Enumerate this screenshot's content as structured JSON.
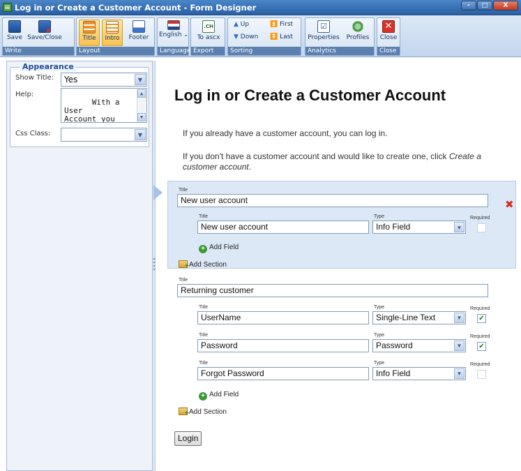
{
  "window": {
    "title": "Log in or Create a Customer Account - Form Designer",
    "controls": [
      "-",
      "□",
      "X"
    ]
  },
  "ribbon": {
    "write": {
      "label": "Write",
      "save": "Save",
      "save_close": "Save/Close"
    },
    "layout": {
      "label": "Layout",
      "title": "Title",
      "intro": "Intro",
      "footer": "Footer"
    },
    "language": {
      "label": "Language",
      "english": "English"
    },
    "export": {
      "label": "Export",
      "to_ascx": "To ascx"
    },
    "sorting": {
      "label": "Sorting",
      "up": "Up",
      "down": "Down",
      "first": "First",
      "last": "Last"
    },
    "analytics": {
      "label": "Analytics",
      "properties": "Properties",
      "profiles": "Profiles"
    },
    "close": {
      "label": "Close",
      "close": "Close"
    }
  },
  "appearance": {
    "legend": "Appearance",
    "show_title_label": "Show Title:",
    "show_title_value": "Yes",
    "help_label": "Help:",
    "help_value": "With a User\nAccount you\nget a faster\ncheckout",
    "css_class_label": "Css Class:",
    "css_class_value": ""
  },
  "form": {
    "heading": "Log in or Create a Customer Account",
    "intro1": "If you already have a customer account, you can log in.",
    "intro2_a": "If you don't have a customer account and would like to create one, click ",
    "intro2_em": "Create a",
    "intro2_b": "customer account",
    "intro2_end": ".",
    "labels": {
      "title": "Title",
      "type": "Type",
      "required": "Required"
    },
    "add_field": "Add Field",
    "add_section": "Add Section",
    "sections": [
      {
        "title": "New user account",
        "fields": [
          {
            "title": "New user account",
            "type": "Info Field",
            "required": false
          }
        ]
      },
      {
        "title": "Returning customer",
        "fields": [
          {
            "title": "UserName",
            "type": "Single-Line Text",
            "required": true
          },
          {
            "title": "Password",
            "type": "Password",
            "required": true
          },
          {
            "title": "Forgot Password",
            "type": "Info Field",
            "required": false
          }
        ]
      }
    ],
    "login_button": "Login"
  }
}
